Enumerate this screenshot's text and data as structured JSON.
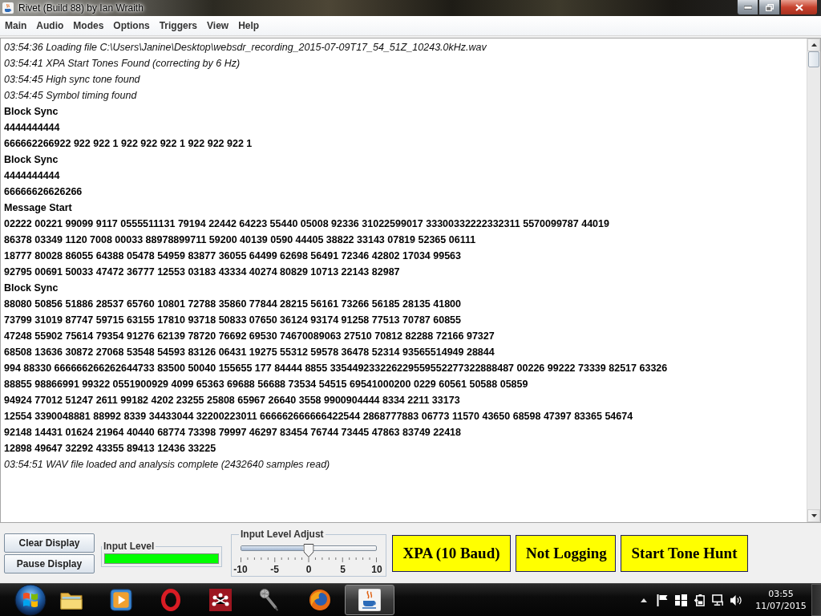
{
  "window": {
    "title": "Rivet (Build 88) by Ian Wraith"
  },
  "menu_bar": [
    "Main",
    "Audio",
    "Modes",
    "Options",
    "Triggers",
    "View",
    "Help"
  ],
  "log": [
    {
      "kind": "event",
      "text": "03:54:36 Loading file C:\\Users\\Janine\\Desktop\\websdr_recording_2015-07-09T17_54_51Z_10243.0kHz.wav"
    },
    {
      "kind": "event",
      "text": "03:54:41 XPA Start Tones Found (correcting by 6 Hz)"
    },
    {
      "kind": "event",
      "text": "03:54:45 High sync tone found"
    },
    {
      "kind": "event",
      "text": "03:54:45 Symbol timing found"
    },
    {
      "kind": "data",
      "text": "Block Sync"
    },
    {
      "kind": "data",
      "text": "4444444444"
    },
    {
      "kind": "data",
      "text": "666662266922 922 922 1 922 922 922 1 922 922 922 1"
    },
    {
      "kind": "data",
      "text": "Block Sync"
    },
    {
      "kind": "data",
      "text": "4444444444"
    },
    {
      "kind": "data",
      "text": "66666626626266"
    },
    {
      "kind": "data",
      "text": "Message Start"
    },
    {
      "kind": "data",
      "text": "02222 00221 99099 9117 0555511131 79194 22442 64223 55440 05008 92336 31022599017 33300332222332311 5570099787 44019"
    },
    {
      "kind": "data",
      "text": "86378 03349 1120 7008 00033 88978899711 59200 40139 0590 44405 38822 33143 07819 52365 06111"
    },
    {
      "kind": "data",
      "text": "18777 80028 86055 64388 05478 54959 83877 36055 64499 62698 56491 72346 42802 17034 99563"
    },
    {
      "kind": "data",
      "text": "92795 00691 50033 47472 36777 12553 03183 43334 40274 80829 10713 22143 82987"
    },
    {
      "kind": "data",
      "text": "Block Sync"
    },
    {
      "kind": "data",
      "text": "88080 50856 51886 28537 65760 10801 72788 35860 77844 28215 56161 73266 56185 28135 41800"
    },
    {
      "kind": "data",
      "text": "73799 31019 87747 59715 63155 17810 93718 50833 07650 36124 93174 91258 77513 70787 60855"
    },
    {
      "kind": "data",
      "text": "47248 55902 75614 79354 91276 62139 78720 76692 69530 74670089063 27510 70812 82288 72166 97327"
    },
    {
      "kind": "data",
      "text": "68508 13636 30872 27068 53548 54593 83126 06431 19275 55312 59578 36478 52314 93565514949 28844"
    },
    {
      "kind": "data",
      "text": "994 88330 666666266262644733 83500 50040 155655 177 84444 8855 335449233226229559552277322888487 00226 99222 73339 82517 63326"
    },
    {
      "kind": "data",
      "text": "88855 98866991 99322 0551900929 4099 65363 69688 56688 73534 54515 69541000200 0229 60561 50588 05859"
    },
    {
      "kind": "data",
      "text": "94924 77012 51247 2611 99182 4202 23255 25808 65967 26640 3558 9900904444 8334 2211 33173"
    },
    {
      "kind": "data",
      "text": "12554 3390048881 88992 8339 34433044 32200223011 666662666666422544 2868777883 06773 11570 43650 68598 47397 83365 54674"
    },
    {
      "kind": "data",
      "text": "92148 14431 01624 21964 40440 68774 73398 79997 46297 83454 76744 73445 47863 83749 22418"
    },
    {
      "kind": "data",
      "text": "12898 49647 32292 43355 89413 12436 33225"
    },
    {
      "kind": "event",
      "text": "03:54:51 WAV file loaded and analysis complete (2432640 samples read)"
    }
  ],
  "controls": {
    "display_buttons": [
      "Clear Display",
      "Pause Display"
    ],
    "input_level": {
      "label": "Input Level",
      "level": 1
    },
    "input_level_adjust": {
      "label": "Input Level Adjust",
      "level": 0.5,
      "scale_labels": [
        "-10",
        "-5",
        "0",
        "5",
        "10"
      ]
    },
    "status_buttons": [
      "XPA (10 Baud)",
      "Not Logging",
      "Start Tone Hunt"
    ]
  },
  "taskbar": {
    "apps": [
      {
        "kind": "folder",
        "selected": false
      },
      {
        "kind": "player",
        "selected": false
      },
      {
        "kind": "ring",
        "selected": false
      },
      {
        "kind": "nodes",
        "selected": false
      },
      {
        "kind": "microphone",
        "selected": false
      },
      {
        "kind": "globe",
        "selected": false
      },
      {
        "kind": "cup",
        "selected": true
      }
    ],
    "clock": {
      "time": "03:55",
      "date": "11/07/2015"
    }
  }
}
